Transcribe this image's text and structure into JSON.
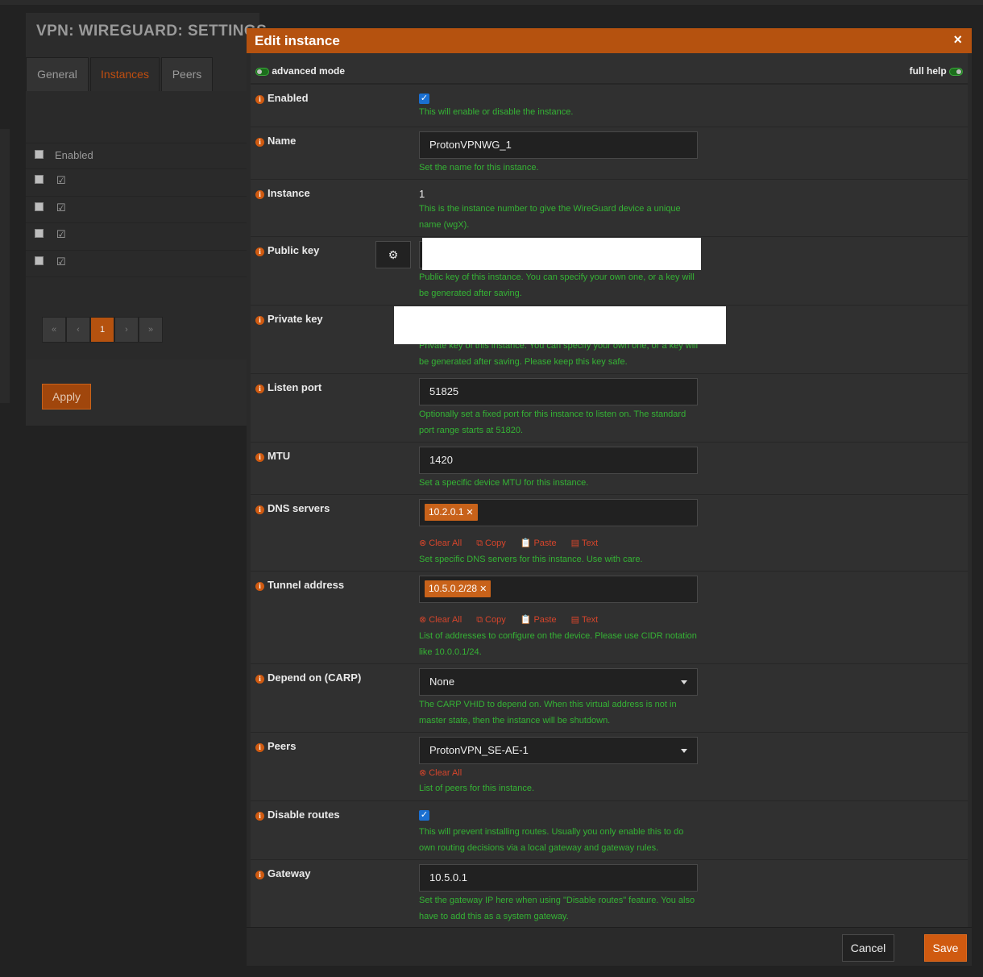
{
  "page": {
    "title": "VPN: WIREGUARD: SETTINGS",
    "tabs": [
      {
        "label": "General",
        "active": false
      },
      {
        "label": "Instances",
        "active": true
      },
      {
        "label": "Peers",
        "active": false
      }
    ],
    "table_header": "Enabled",
    "rows_checked": [
      true,
      true,
      true,
      true
    ],
    "pager": [
      "«",
      "‹",
      "1",
      "›",
      "»"
    ],
    "current_page": "1",
    "apply_label": "Apply"
  },
  "modal": {
    "title": "Edit instance",
    "close": "×",
    "advanced_mode_label": "advanced mode",
    "full_help_label": "full help",
    "fields": {
      "enabled": {
        "label": "Enabled",
        "checked": true,
        "help": "This will enable or disable the instance."
      },
      "name": {
        "label": "Name",
        "value": "ProtonVPNWG_1",
        "help": "Set the name for this instance."
      },
      "instance": {
        "label": "Instance",
        "value": "1",
        "help": "This is the instance number to give the WireGuard device a unique name (wgX)."
      },
      "public_key": {
        "label": "Public key",
        "help": "Public key of this instance. You can specify your own one, or a key will be generated after saving."
      },
      "private_key": {
        "label": "Private key",
        "help": "Private key of this instance. You can specify your own one, or a key will be generated after saving. Please keep this key safe."
      },
      "listen_port": {
        "label": "Listen port",
        "value": "51825",
        "help": "Optionally set a fixed port for this instance to listen on. The standard port range starts at 51820."
      },
      "mtu": {
        "label": "MTU",
        "value": "1420",
        "help": "Set a specific device MTU for this instance."
      },
      "dns_servers": {
        "label": "DNS servers",
        "tokens": [
          "10.2.0.1"
        ],
        "help": "Set specific DNS servers for this instance. Use with care."
      },
      "tunnel_address": {
        "label": "Tunnel address",
        "tokens": [
          "10.5.0.2/28"
        ],
        "help": "List of addresses to configure on the device. Please use CIDR notation like 10.0.0.1/24."
      },
      "depend_on": {
        "label": "Depend on (CARP)",
        "value": "None",
        "help": "The CARP VHID to depend on. When this virtual address is not in master state, then the instance will be shutdown."
      },
      "peers": {
        "label": "Peers",
        "value": "ProtonVPN_SE-AE-1",
        "help": "List of peers for this instance."
      },
      "disable_routes": {
        "label": "Disable routes",
        "checked": true,
        "help": "This will prevent installing routes. Usually you only enable this to do own routing decisions via a local gateway and gateway rules."
      },
      "gateway": {
        "label": "Gateway",
        "value": "10.5.0.1",
        "help": "Set the gateway IP here when using \"Disable routes\" feature. You also have to add this as a system gateway."
      }
    },
    "token_actions": {
      "clear_all": "Clear All",
      "copy": "Copy",
      "paste": "Paste",
      "text": "Text"
    },
    "cancel_label": "Cancel",
    "save_label": "Save"
  },
  "colors": {
    "accent": "#b5520f",
    "help_text": "#35b335",
    "action_red": "#d6452b",
    "checkbox": "#1a6fd1"
  },
  "icons": {
    "info": "info-icon",
    "gear": "gear-icon",
    "clear": "clear-circle-icon",
    "copy": "copy-icon",
    "paste": "paste-icon",
    "text": "text-icon",
    "caret": "chevron-down-icon"
  }
}
